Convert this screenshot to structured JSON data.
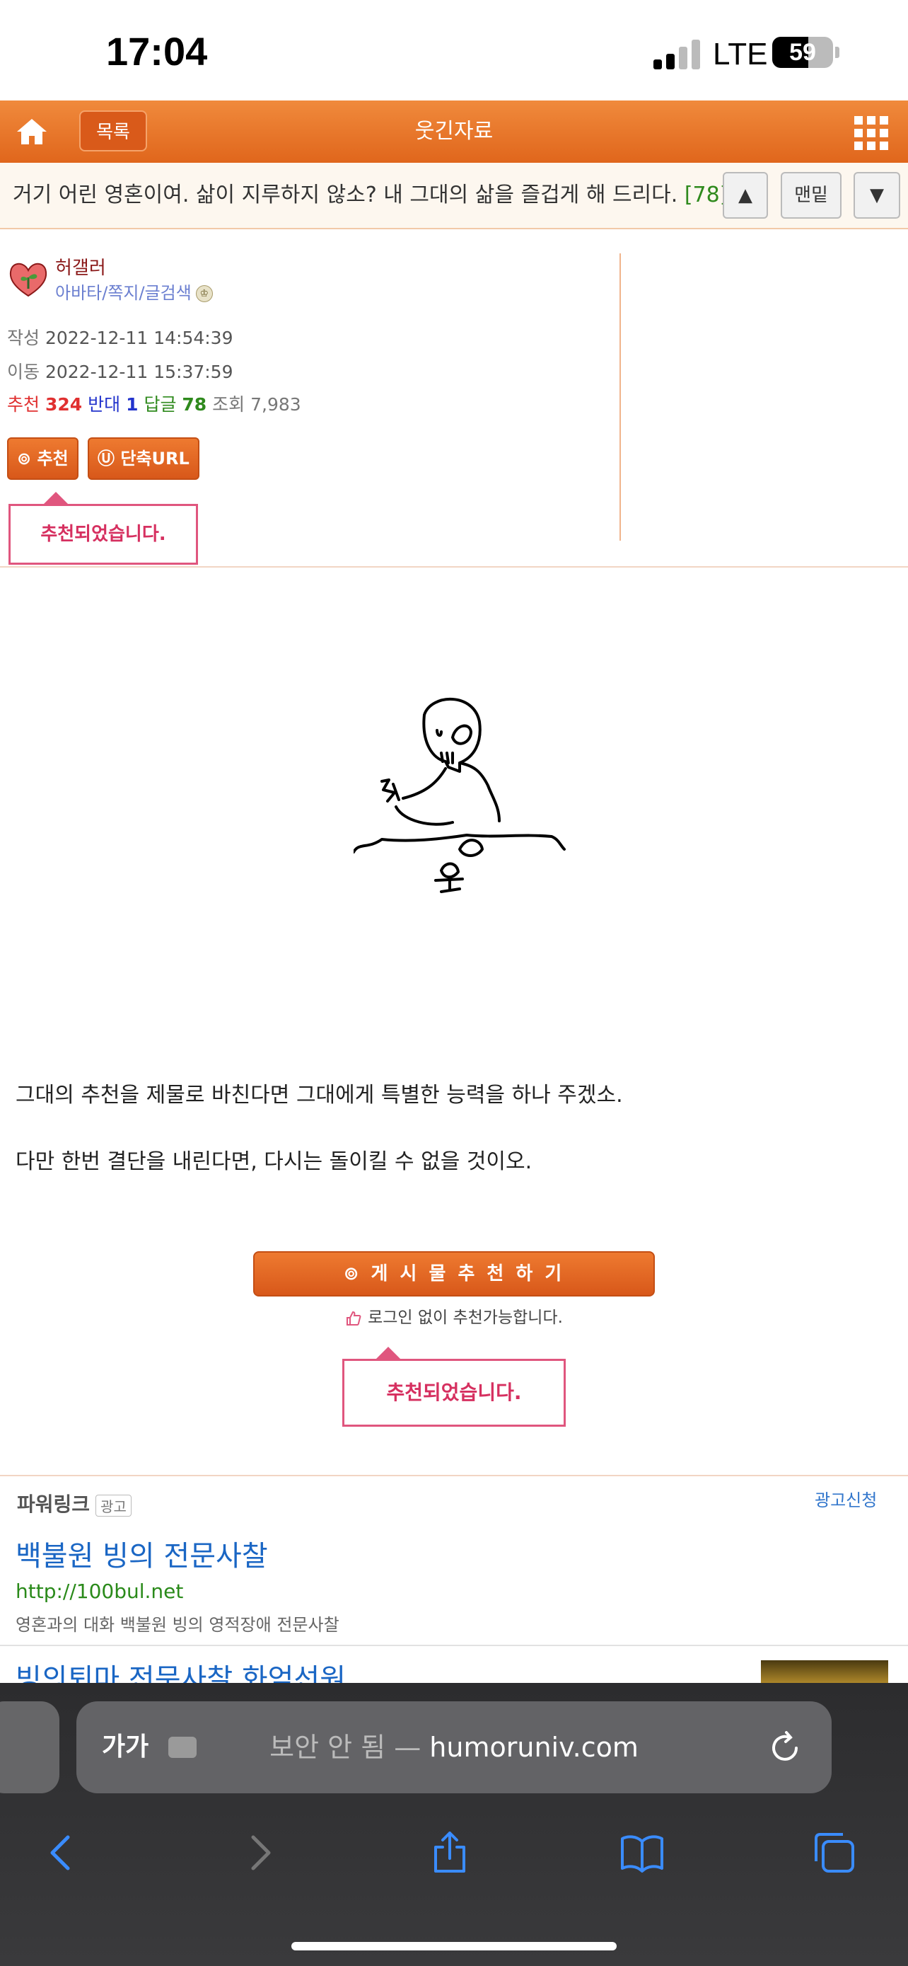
{
  "status_bar": {
    "time": "17:04",
    "network": "LTE",
    "battery": "59",
    "battery_level": 0.59
  },
  "header": {
    "list_label": "목록",
    "title": "웃긴자료"
  },
  "post": {
    "title": "거기 어린 영혼이여. 삶이 지루하지 않소? 내 그대의 삶을 즐겁게 해 드리다.",
    "comment_count": "[78]",
    "nav": {
      "up": "▲",
      "bottom": "맨밑",
      "down": "▼"
    }
  },
  "author": {
    "name": "허갤러",
    "links": "아바타/쪽지/글검색",
    "written_label": "작성",
    "written": "2022-12-11 14:54:39",
    "moved_label": "이동",
    "moved": "2022-12-11 15:37:59",
    "rec_label": "추천",
    "rec_count": "324",
    "opp_label": "반대",
    "opp_count": "1",
    "reply_label": "답글",
    "reply_count": "78",
    "view_label": "조회",
    "view_count": "7,983",
    "rec_button": "⊚ 추천",
    "short_url_button": "Ⓤ 단축URL",
    "popup": "추천되었습니다."
  },
  "content": {
    "line1": "그대의 추천을 제물로 바친다면 그대에게 특별한 능력을 하나 주겠소.",
    "line2": "다만 한번 결단을 내린다면, 다시는 돌이킬 수 없을 것이오.",
    "recommend_button": "⊚ 게 시 물   추 천 하 기",
    "login_note": "로그인 없이 추천가능합니다.",
    "popup": "추천되었습니다."
  },
  "ads": {
    "label": "파워링크",
    "tag": "광고",
    "apply": "광고신청",
    "ad1_title": "백불원 빙의 전문사찰",
    "ad1_url": "http://100bul.net",
    "ad1_desc": "영혼과의 대화 백불원 빙의 영적장애 전문사찰",
    "ad2_title": "빙의퇴마 전문사찰 화엄선원"
  },
  "safari": {
    "aa": "가가",
    "insecure": "보안 안 됨 —",
    "domain": "humoruniv.com"
  },
  "icons": [
    "home-icon",
    "grid-menu-icon",
    "avatar-icon",
    "thumbs-up-icon",
    "puzzle-extension-icon",
    "reload-icon",
    "back-icon",
    "forward-icon",
    "share-icon",
    "bookmarks-icon",
    "tabs-icon"
  ],
  "colors": {
    "accent": "#e8721f",
    "popup": "#e0567e",
    "link": "#1a66c4"
  }
}
